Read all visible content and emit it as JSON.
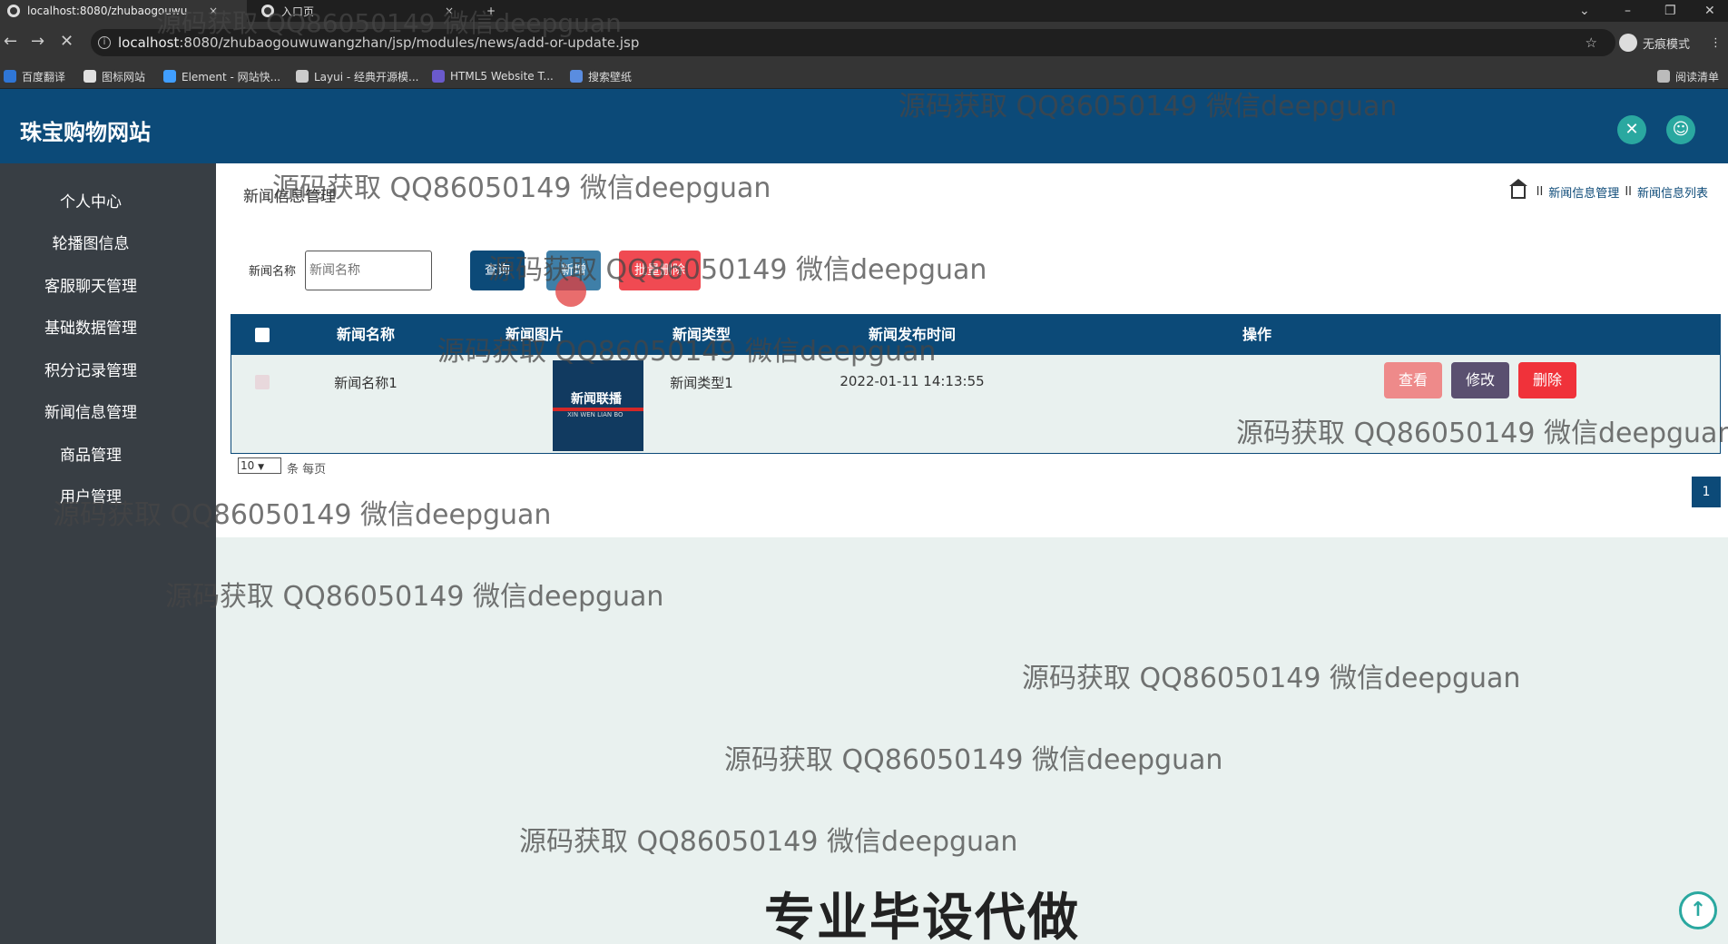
{
  "browser": {
    "tabs": [
      {
        "title": "localhost:8080/zhubaogouwu"
      },
      {
        "title": "入口页"
      }
    ],
    "new_tab": "+",
    "close_glyph": "×",
    "url_host": "localhost",
    "url_rest": ":8080/zhubaogouwuwangzhan/jsp/modules/news/add-or-update.jsp",
    "incognito_label": "无痕模式",
    "reading_list": "阅读清单",
    "bookmarks": [
      {
        "label": "百度翻译",
        "color": "#2f76d6"
      },
      {
        "label": "图标网站",
        "color": "#e0e0e0"
      },
      {
        "label": "Element - 网站快...",
        "color": "#409eff"
      },
      {
        "label": "Layui - 经典开源模...",
        "color": "#cccccc"
      },
      {
        "label": "HTML5 Website T...",
        "color": "#6a5acd"
      },
      {
        "label": "搜索壁纸",
        "color": "#5a8de0"
      }
    ]
  },
  "app": {
    "title": "珠宝购物网站",
    "header_icons": [
      "expand-icon",
      "user-icon"
    ],
    "accent": "#0c4a78"
  },
  "sidebar": {
    "items": [
      {
        "label": "个人中心"
      },
      {
        "label": "轮播图信息"
      },
      {
        "label": "客服聊天管理"
      },
      {
        "label": "基础数据管理"
      },
      {
        "label": "积分记录管理"
      },
      {
        "label": "新闻信息管理"
      },
      {
        "label": "商品管理"
      },
      {
        "label": "用户管理"
      }
    ]
  },
  "page": {
    "title": "新闻信息管理",
    "breadcrumb": [
      "新闻信息管理",
      "新闻信息列表"
    ],
    "breadcrumb_sep": "II"
  },
  "search": {
    "label": "新闻名称",
    "placeholder": "新闻名称",
    "query_button": "查询",
    "add_button": "新增",
    "delete_button": "批量删除"
  },
  "table": {
    "columns": [
      "新闻名称",
      "新闻图片",
      "新闻类型",
      "新闻发布时间",
      "操作"
    ],
    "rows": [
      {
        "name": "新闻名称1",
        "image_title": "新闻联播",
        "image_sub": "XIN WEN LIAN BO",
        "type": "新闻类型1",
        "time": "2022-01-11 14:13:55",
        "actions": [
          "查看",
          "修改",
          "删除"
        ]
      }
    ]
  },
  "pager": {
    "page_size": "10",
    "page_size_suffix": "条 每页",
    "current_page": "1"
  },
  "overlay": {
    "watermark": "源码获取 QQ86050149 微信deepguan",
    "promo": "专业毕设代做"
  }
}
